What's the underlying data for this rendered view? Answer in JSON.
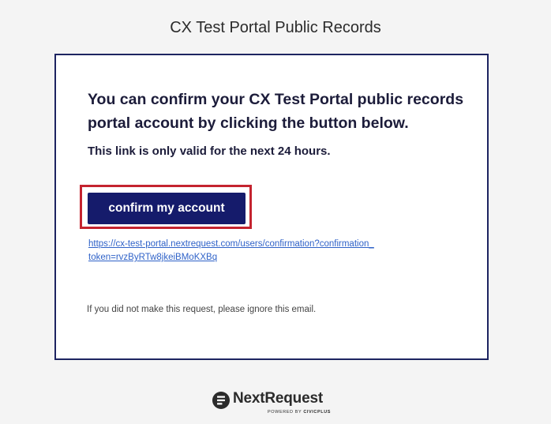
{
  "header": {
    "title": "CX Test Portal Public Records"
  },
  "email": {
    "headline": "You can confirm your CX Test Portal public records portal account by clicking the button below.",
    "validity_note": "This link is only valid for the next 24 hours.",
    "confirm_button_label": "confirm my account",
    "confirmation_link_line1": "https://cx-test-portal.nextrequest.com/users/confirmation?confirmation_",
    "confirmation_link_line2": "token=rvzByRTw8jkeiBMoKXBq",
    "ignore_note": "If you did not make this request, please ignore this email."
  },
  "footer": {
    "logo_text": "NextRequest",
    "powered_by": "POWERED BY",
    "powered_by_brand": "CIVICPLUS",
    "logo_icon": "nextrequest-logo-icon"
  },
  "colors": {
    "brand_navy": "#151b6b",
    "card_border": "#1d2461",
    "highlight_red": "#c4232f",
    "link_blue": "#2f62c8"
  }
}
